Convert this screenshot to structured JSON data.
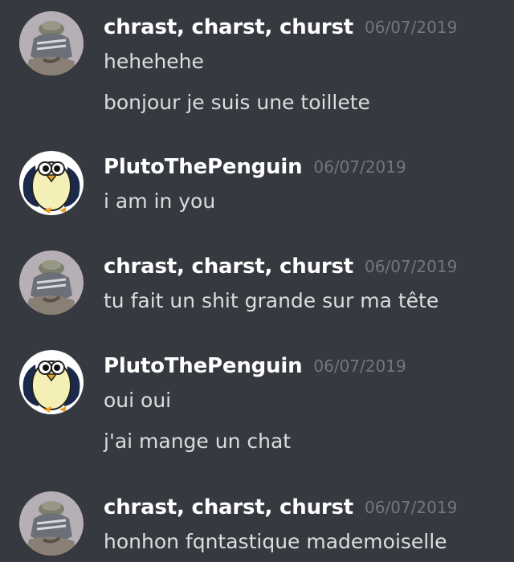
{
  "messages": [
    {
      "username": "chrast, charst, churst",
      "timestamp": "06/07/2019",
      "avatar": "gray-knit-hat-avatar",
      "lines": [
        "hehehehe",
        "bonjour je suis une toillete"
      ]
    },
    {
      "username": "PlutoThePenguin",
      "timestamp": "06/07/2019",
      "avatar": "penguin-avatar",
      "lines": [
        "i am in you"
      ]
    },
    {
      "username": "chrast, charst, churst",
      "timestamp": "06/07/2019",
      "avatar": "gray-knit-hat-avatar",
      "lines": [
        "tu fait un shit grande sur ma tête"
      ]
    },
    {
      "username": "PlutoThePenguin",
      "timestamp": "06/07/2019",
      "avatar": "penguin-avatar",
      "lines": [
        "oui oui",
        "j'ai mange un chat"
      ]
    },
    {
      "username": "chrast, charst, churst",
      "timestamp": "06/07/2019",
      "avatar": "gray-knit-hat-avatar",
      "lines": [
        "honhon fqntastique mademoiselle"
      ]
    }
  ],
  "colors": {
    "background": "#36393f",
    "username": "#ffffff",
    "timestamp": "#72767d",
    "message_text": "#dcddde"
  }
}
